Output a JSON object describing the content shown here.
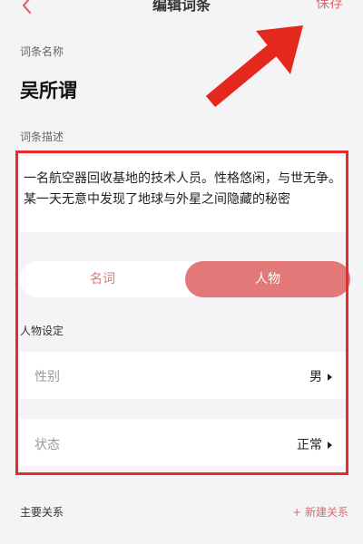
{
  "header": {
    "title": "编辑词条",
    "save_label": "保存"
  },
  "form": {
    "name_label": "词条名称",
    "name_value": "吴所谓",
    "desc_label": "词条描述",
    "desc_value": "一名航空器回收基地的技术人员。性格悠闲，与世无争。某一天无意中发现了地球与外星之间隐藏的秘密",
    "type_tabs": [
      {
        "label": "名词",
        "selected": false
      },
      {
        "label": "人物",
        "selected": true
      }
    ],
    "character_settings_label": "人物设定",
    "rows": [
      {
        "label": "性别",
        "value": "男"
      },
      {
        "label": "状态",
        "value": "正常"
      }
    ],
    "relations_label": "主要关系",
    "new_relation_label": "+ 新建关系"
  },
  "colors": {
    "accent": "#e27878",
    "highlight_box": "#e52b2b",
    "annotation_arrow": "#e5281e"
  }
}
